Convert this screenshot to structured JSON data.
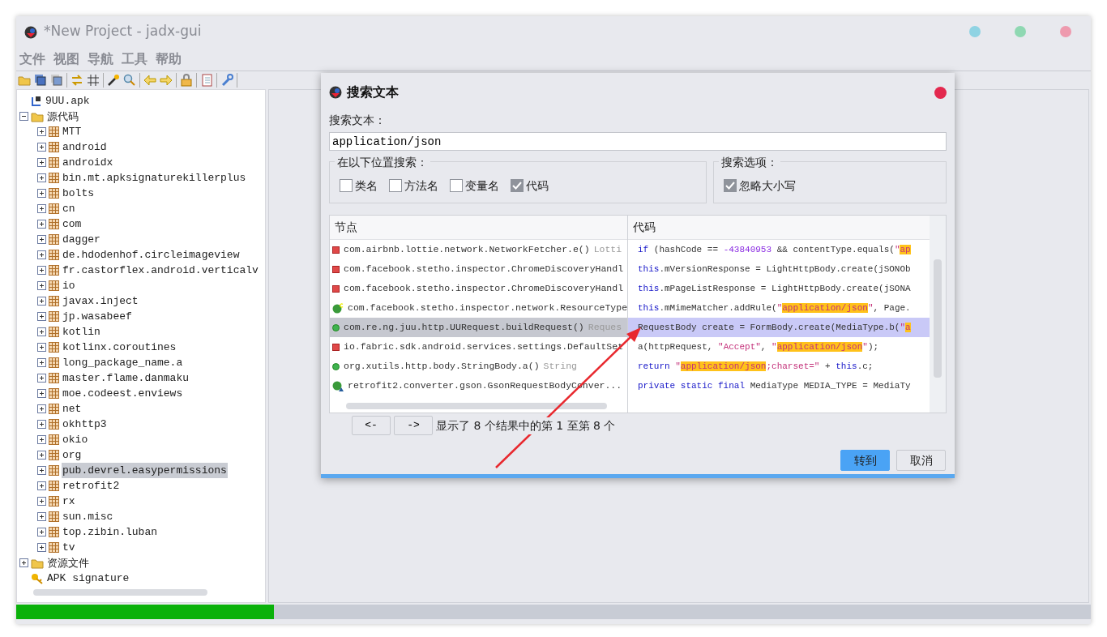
{
  "window": {
    "title": "*New Project - jadx-gui"
  },
  "menu": [
    "文件",
    "视图",
    "导航",
    "工具",
    "帮助"
  ],
  "tree": [
    {
      "label": "9UU.apk",
      "kind": "apk"
    },
    {
      "label": "源代码",
      "kind": "source",
      "expanded": true,
      "children": [
        {
          "label": "MTT",
          "kind": "package",
          "expanded": false,
          "selected": false
        },
        {
          "label": "android",
          "kind": "package",
          "expanded": false,
          "selected": false
        },
        {
          "label": "androidx",
          "kind": "package",
          "expanded": false,
          "selected": false
        },
        {
          "label": "bin.mt.apksignaturekillerplus",
          "kind": "package",
          "expanded": false,
          "selected": false
        },
        {
          "label": "bolts",
          "kind": "package",
          "expanded": false,
          "selected": false
        },
        {
          "label": "cn",
          "kind": "package",
          "expanded": false,
          "selected": false
        },
        {
          "label": "com",
          "kind": "package",
          "expanded": false,
          "selected": false
        },
        {
          "label": "dagger",
          "kind": "package",
          "expanded": false,
          "selected": false
        },
        {
          "label": "de.hdodenhof.circleimageview",
          "kind": "package",
          "expanded": false,
          "selected": false
        },
        {
          "label": "fr.castorflex.android.verticalv",
          "kind": "package",
          "expanded": false,
          "selected": false
        },
        {
          "label": "io",
          "kind": "package",
          "expanded": false,
          "selected": false
        },
        {
          "label": "javax.inject",
          "kind": "package",
          "expanded": false,
          "selected": false
        },
        {
          "label": "jp.wasabeef",
          "kind": "package",
          "expanded": false,
          "selected": false
        },
        {
          "label": "kotlin",
          "kind": "package",
          "expanded": false,
          "selected": false
        },
        {
          "label": "kotlinx.coroutines",
          "kind": "package",
          "expanded": false,
          "selected": false
        },
        {
          "label": "long_package_name.a",
          "kind": "package",
          "expanded": false,
          "selected": false
        },
        {
          "label": "master.flame.danmaku",
          "kind": "package",
          "expanded": false,
          "selected": false
        },
        {
          "label": "moe.codeest.enviews",
          "kind": "package",
          "expanded": false,
          "selected": false
        },
        {
          "label": "net",
          "kind": "package",
          "expanded": false,
          "selected": false
        },
        {
          "label": "okhttp3",
          "kind": "package",
          "expanded": false,
          "selected": false
        },
        {
          "label": "okio",
          "kind": "package",
          "expanded": false,
          "selected": false
        },
        {
          "label": "org",
          "kind": "package",
          "expanded": false,
          "selected": false
        },
        {
          "label": "pub.devrel.easypermissions",
          "kind": "package",
          "expanded": false,
          "selected": true
        },
        {
          "label": "retrofit2",
          "kind": "package",
          "expanded": false,
          "selected": false
        },
        {
          "label": "rx",
          "kind": "package",
          "expanded": false,
          "selected": false
        },
        {
          "label": "sun.misc",
          "kind": "package",
          "expanded": false,
          "selected": false
        },
        {
          "label": "top.zibin.luban",
          "kind": "package",
          "expanded": false,
          "selected": false
        },
        {
          "label": "tv",
          "kind": "package",
          "expanded": false,
          "selected": false
        }
      ]
    },
    {
      "label": "资源文件",
      "kind": "resources",
      "expanded": false
    },
    {
      "label": "APK signature",
      "kind": "signature"
    }
  ],
  "progress": {
    "level": 0.24
  },
  "dialog": {
    "title": "搜索文本",
    "search_label": "搜索文本：",
    "search_value": "application/json",
    "scope": {
      "title": "在以下位置搜索：",
      "options": [
        {
          "label": "类名",
          "checked": false
        },
        {
          "label": "方法名",
          "checked": false
        },
        {
          "label": "变量名",
          "checked": false
        },
        {
          "label": "代码",
          "checked": true
        }
      ]
    },
    "options": {
      "title": "搜索选项：",
      "options": [
        {
          "label": "忽略大小写",
          "checked": true
        }
      ]
    },
    "columns": [
      "节点",
      "代码"
    ],
    "results": [
      {
        "kind": "private-method",
        "node": "com.airbnb.lottie.network.NetworkFetcher.e()",
        "hint": "Lotti",
        "selected": false,
        "code": [
          {
            "kind": "kw",
            "text": "if"
          },
          {
            "kind": "plain",
            "text": " (hashCode == "
          },
          {
            "kind": "num",
            "text": "-43840953"
          },
          {
            "kind": "plain",
            "text": " && contentType.equals("
          },
          {
            "kind": "str",
            "text": "\""
          },
          {
            "kind": "match",
            "text": "ap"
          }
        ]
      },
      {
        "kind": "private-method",
        "node": "com.facebook.stetho.inspector.ChromeDiscoveryHandl",
        "selected": false,
        "code": [
          {
            "kind": "kw",
            "text": "this"
          },
          {
            "kind": "plain",
            "text": ".mVersionResponse = LightHttpBody.create(jSONOb"
          }
        ]
      },
      {
        "kind": "private-method",
        "node": "com.facebook.stetho.inspector.ChromeDiscoveryHandl",
        "selected": false,
        "code": [
          {
            "kind": "kw",
            "text": "this"
          },
          {
            "kind": "plain",
            "text": ".mPageListResponse = LightHttpBody.create(jSONA"
          }
        ]
      },
      {
        "kind": "class",
        "node": "com.facebook.stetho.inspector.network.ResourceType",
        "selected": false,
        "code": [
          {
            "kind": "kw",
            "text": "this"
          },
          {
            "kind": "plain",
            "text": ".mMimeMatcher.addRule("
          },
          {
            "kind": "str",
            "text": "\""
          },
          {
            "kind": "match",
            "text": "application/json"
          },
          {
            "kind": "str",
            "text": "\""
          },
          {
            "kind": "plain",
            "text": ", Page."
          }
        ]
      },
      {
        "kind": "public-method",
        "node": "com.re.ng.juu.http.UURequest.buildRequest()",
        "hint": "Reques",
        "selected": true,
        "code": [
          {
            "kind": "plain",
            "text": "RequestBody create = FormBody.create(MediaType.b("
          },
          {
            "kind": "str",
            "text": "\""
          },
          {
            "kind": "match",
            "text": "a"
          }
        ]
      },
      {
        "kind": "private-method",
        "node": "io.fabric.sdk.android.services.settings.DefaultSet",
        "selected": false,
        "code": [
          {
            "kind": "plain",
            "text": "a(httpRequest, "
          },
          {
            "kind": "str",
            "text": "\"Accept\""
          },
          {
            "kind": "plain",
            "text": ", "
          },
          {
            "kind": "str",
            "text": "\""
          },
          {
            "kind": "match",
            "text": "application/json"
          },
          {
            "kind": "str",
            "text": "\""
          },
          {
            "kind": "plain",
            "text": ");"
          }
        ]
      },
      {
        "kind": "public-method",
        "node": "org.xutils.http.body.StringBody.a()",
        "hint": "String",
        "selected": false,
        "code": [
          {
            "kind": "kw",
            "text": "return"
          },
          {
            "kind": "str",
            "text": " \""
          },
          {
            "kind": "match",
            "text": "application/json"
          },
          {
            "kind": "str",
            "text": ";charset=\""
          },
          {
            "kind": "plain",
            "text": " + "
          },
          {
            "kind": "kw",
            "text": "this"
          },
          {
            "kind": "plain",
            "text": ".c;"
          }
        ]
      },
      {
        "kind": "abstract-class",
        "node": "retrofit2.converter.gson.GsonRequestBodyConver...",
        "selected": false,
        "code": [
          {
            "kind": "kw",
            "text": "private static final"
          },
          {
            "kind": "plain",
            "text": " MediaType MEDIA_TYPE = MediaTy"
          }
        ]
      }
    ],
    "prev": "<-",
    "next": "->",
    "summary": "显示了 8 个结果中的第 1 至第 8 个",
    "buttons": [
      {
        "label": "转到",
        "kind": "primary"
      },
      {
        "label": "取消",
        "kind": "secondary"
      }
    ]
  }
}
